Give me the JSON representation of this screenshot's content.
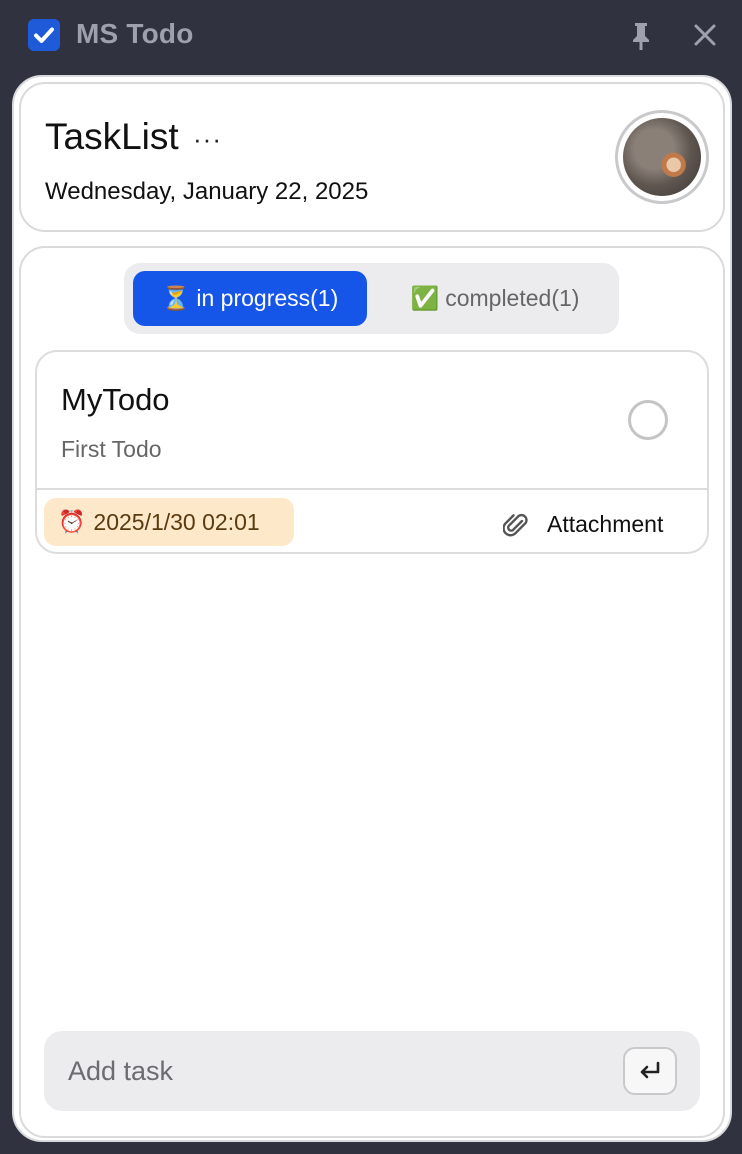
{
  "titlebar": {
    "app_title": "MS Todo",
    "logo_icon": "checkbox-icon",
    "pin_icon": "pin-icon",
    "close_icon": "close-icon"
  },
  "header": {
    "title": "TaskList",
    "more_label": "···",
    "date": "Wednesday, January 22, 2025",
    "avatar": "cat-avatar"
  },
  "tabs": [
    {
      "icon": "⏳",
      "label": "in progress(1)",
      "active": true
    },
    {
      "icon": "✅",
      "label": "completed(1)",
      "active": false
    }
  ],
  "todos": [
    {
      "title": "MyTodo",
      "description": "First Todo",
      "due": "2025/1/30 02:01",
      "due_icon": "⏰",
      "attachment_label": "Attachment",
      "attachment_icon": "paperclip-icon",
      "completed": false
    }
  ],
  "add_task": {
    "placeholder": "Add task",
    "submit_icon": "enter-icon"
  },
  "colors": {
    "accent": "#1556e8",
    "titlebar_bg": "#30323f",
    "due_badge_bg": "#fde8c9"
  }
}
